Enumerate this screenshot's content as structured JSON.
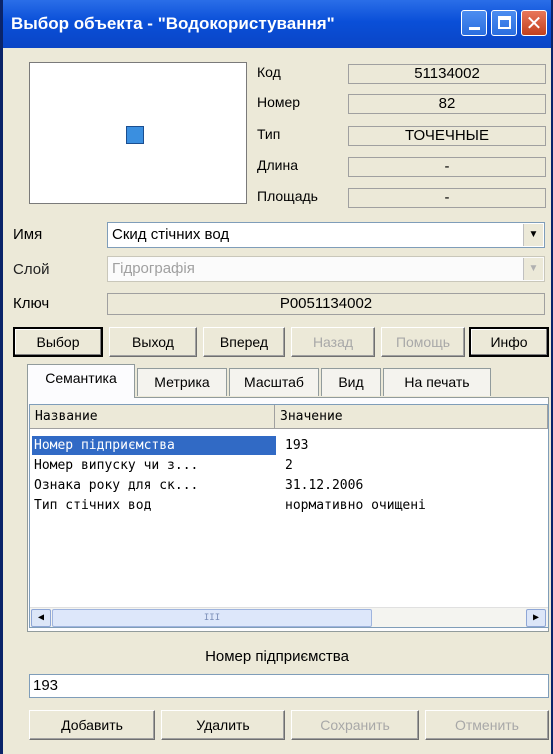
{
  "window": {
    "title": "Выбор объекта - \"Водокористування\""
  },
  "info": {
    "code_label": "Код",
    "code_value": "51134002",
    "number_label": "Номер",
    "number_value": "82",
    "type_label": "Тип",
    "type_value": "ТОЧЕЧНЫЕ",
    "length_label": "Длина",
    "length_value": "-",
    "area_label": "Площадь",
    "area_value": "-"
  },
  "name_row": {
    "label": "Имя",
    "value": "Скид стічних вод"
  },
  "layer_row": {
    "label": "Слой",
    "value": "Гідрографія"
  },
  "key_row": {
    "label": "Ключ",
    "value": "P0051134002"
  },
  "buttons": {
    "select": "Выбор",
    "exit": "Выход",
    "forward": "Вперед",
    "back": "Назад",
    "help": "Помощь",
    "info": "Инфо"
  },
  "tabs": [
    "Семантика",
    "Метрика",
    "Масштаб",
    "Вид",
    "На печать"
  ],
  "list": {
    "col_name": "Название",
    "col_value": "Значение",
    "rows": [
      {
        "name": "Номер підприємства",
        "value": "193"
      },
      {
        "name": "Номер випуску чи з...",
        "value": "2"
      },
      {
        "name": "Ознака року для ск...",
        "value": "31.12.2006"
      },
      {
        "name": "Тип стічних вод",
        "value": "нормативно очищені"
      }
    ]
  },
  "scroll_grip": "III",
  "field": {
    "caption": "Номер підприємства",
    "value": "193"
  },
  "bottom_buttons": {
    "add": "Добавить",
    "delete": "Удалить",
    "save": "Сохранить",
    "cancel": "Отменить"
  },
  "colors": {
    "titlebar": "#0a4fd8",
    "selection": "#316ac5",
    "shape": "#3a8fe0"
  }
}
